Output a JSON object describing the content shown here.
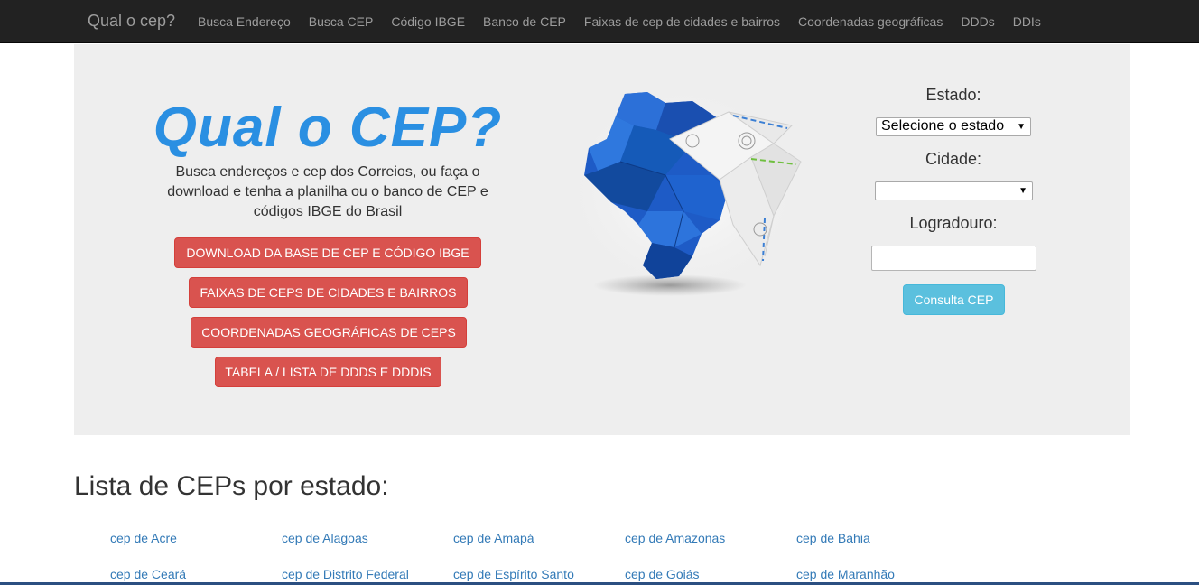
{
  "navbar": {
    "brand": "Qual o cep?",
    "links": [
      "Busca Endereço",
      "Busca CEP",
      "Código IBGE",
      "Banco de CEP",
      "Faixas de cep de cidades e bairros",
      "Coordenadas geográficas",
      "DDDs",
      "DDIs"
    ]
  },
  "hero": {
    "title": "Qual o CEP?",
    "subtitle": "Busca endereços e cep dos Correios, ou faça o download e tenha a planilha ou o banco de CEP e códigos IBGE do Brasil",
    "buttons": [
      "DOWNLOAD DA BASE DE CEP E CÓDIGO IBGE",
      "FAIXAS DE CEPs DE CIDADES E BAIRROS",
      "COORDENADAS GEOGRÁFICAS DE CEPs",
      "TABELA / LISTA DE DDDs E DDDIs"
    ],
    "image_icon": "brazil-origami-map-icon"
  },
  "form": {
    "estado_label": "Estado:",
    "estado_selected": "Selecione o estado",
    "cidade_label": "Cidade:",
    "cidade_selected": "",
    "logradouro_label": "Logradouro:",
    "logradouro_value": "",
    "submit_label": "Consulta CEP"
  },
  "states_section": {
    "title": "Lista de CEPs por estado:",
    "links": [
      "cep de Acre",
      "cep de Alagoas",
      "cep de Amapá",
      "cep de Amazonas",
      "cep de Bahia",
      "cep de Ceará",
      "cep de Distrito Federal",
      "cep de Espírito Santo",
      "cep de Goiás",
      "cep de Maranhão"
    ]
  },
  "colors": {
    "navbar_bg": "#222222",
    "nav_text": "#9d9d9d",
    "jumbotron_bg": "#eeeeee",
    "title_blue": "#2a8fe2",
    "danger": "#d9534f",
    "info": "#5bc0de",
    "link": "#337ab7"
  }
}
